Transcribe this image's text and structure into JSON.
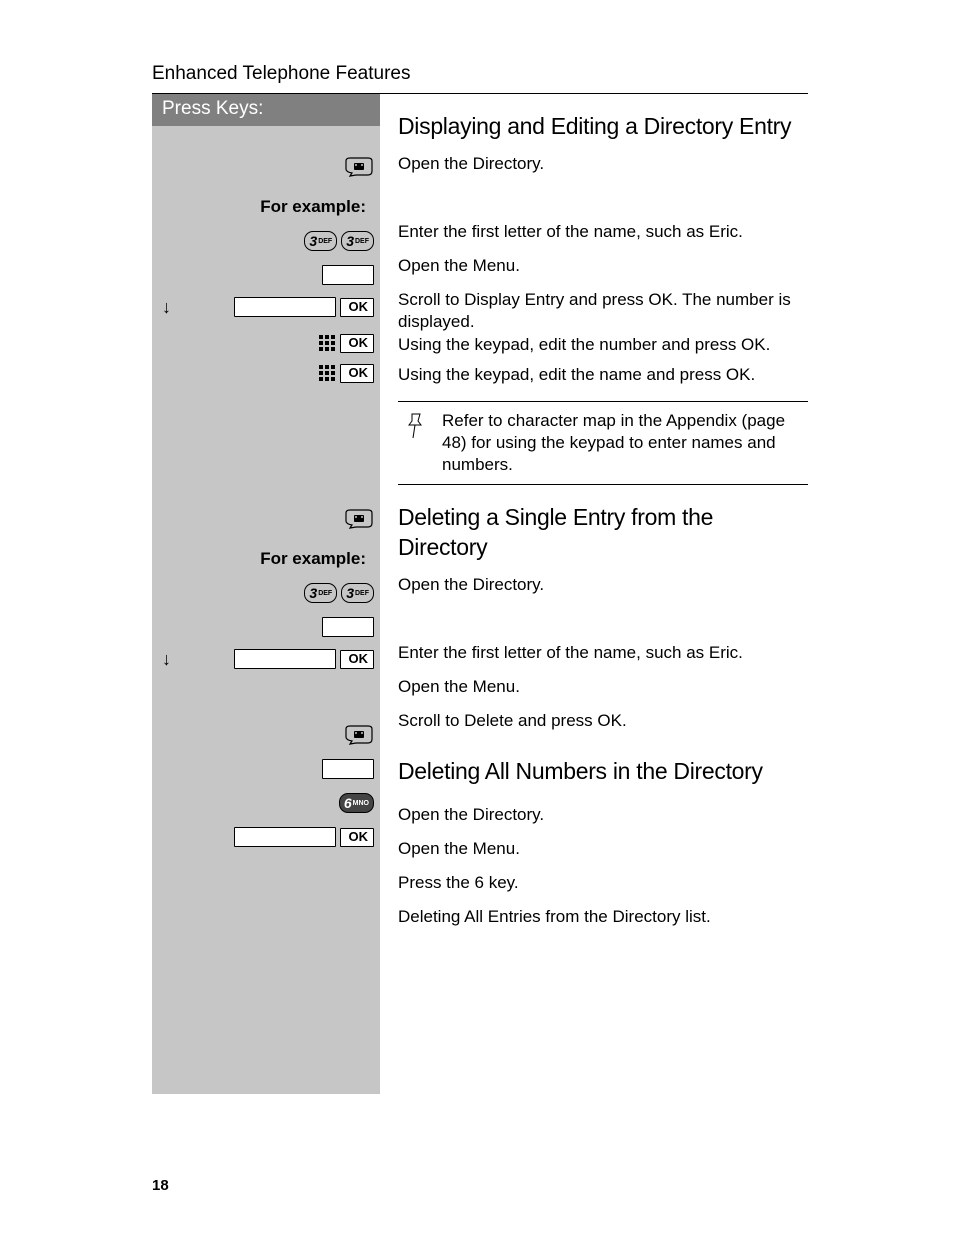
{
  "header": "Enhanced Telephone Features",
  "press_keys_label": "Press Keys:",
  "for_example": "For example:",
  "ok_label": "OK",
  "key3": {
    "num": "3",
    "letters": "DEF"
  },
  "key6": {
    "num": "6",
    "letters": "MNO"
  },
  "sections": {
    "s1": {
      "title": "Displaying and Editing a Directory Entry",
      "open_dir": "Open the Directory.",
      "enter_first": "Enter the first letter of the name, such as Eric.",
      "open_menu": "Open the Menu.",
      "scroll_display": "Scroll to Display Entry and press OK. The number is displayed.",
      "edit_number": "Using the keypad, edit the number and press OK.",
      "edit_name": "Using the keypad, edit the name and press OK.",
      "note": "Refer to character map in the Appendix (page 48) for using the keypad to enter names and numbers."
    },
    "s2": {
      "title": "Deleting a Single Entry from the Directory",
      "open_dir": "Open the Directory.",
      "enter_first": "Enter the first letter of the name, such as Eric.",
      "open_menu": "Open the Menu.",
      "scroll_delete": "Scroll to Delete and press OK."
    },
    "s3": {
      "title": "Deleting All Numbers in the Directory",
      "open_dir": "Open the Directory.",
      "open_menu": "Open the Menu.",
      "press6": "Press the 6 key.",
      "delete_all": "Deleting All Entries from the Directory list."
    }
  },
  "page_number": "18"
}
